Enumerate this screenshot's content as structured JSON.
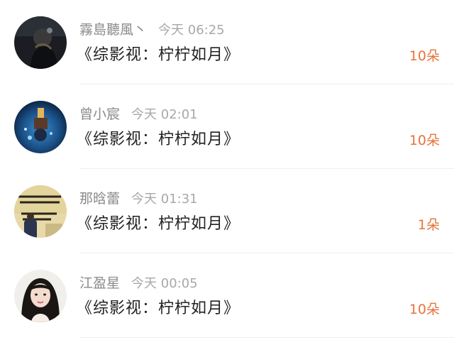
{
  "items": [
    {
      "username": "霧島聽風丶",
      "time": "今天 06:25",
      "title": "《综影视：柠柠如月》",
      "count": "10朵",
      "avatar_icon": "dark-portrait-avatar"
    },
    {
      "username": "曾小宸",
      "time": "今天 02:01",
      "title": "《综影视：柠柠如月》",
      "count": "10朵",
      "avatar_icon": "blue-night-photo-avatar"
    },
    {
      "username": "那晗蕾",
      "time": "今天 01:31",
      "title": "《综影视：柠柠如月》",
      "count": "1朵",
      "avatar_icon": "poster-wall-avatar"
    },
    {
      "username": "江盈星",
      "time": "今天 00:05",
      "title": "《综影视：柠柠如月》",
      "count": "10朵",
      "avatar_icon": "girl-portrait-avatar"
    }
  ],
  "colors": {
    "accent": "#e6743b",
    "username": "#8a8a8a",
    "time": "#a8a8a8",
    "title": "#222222"
  }
}
